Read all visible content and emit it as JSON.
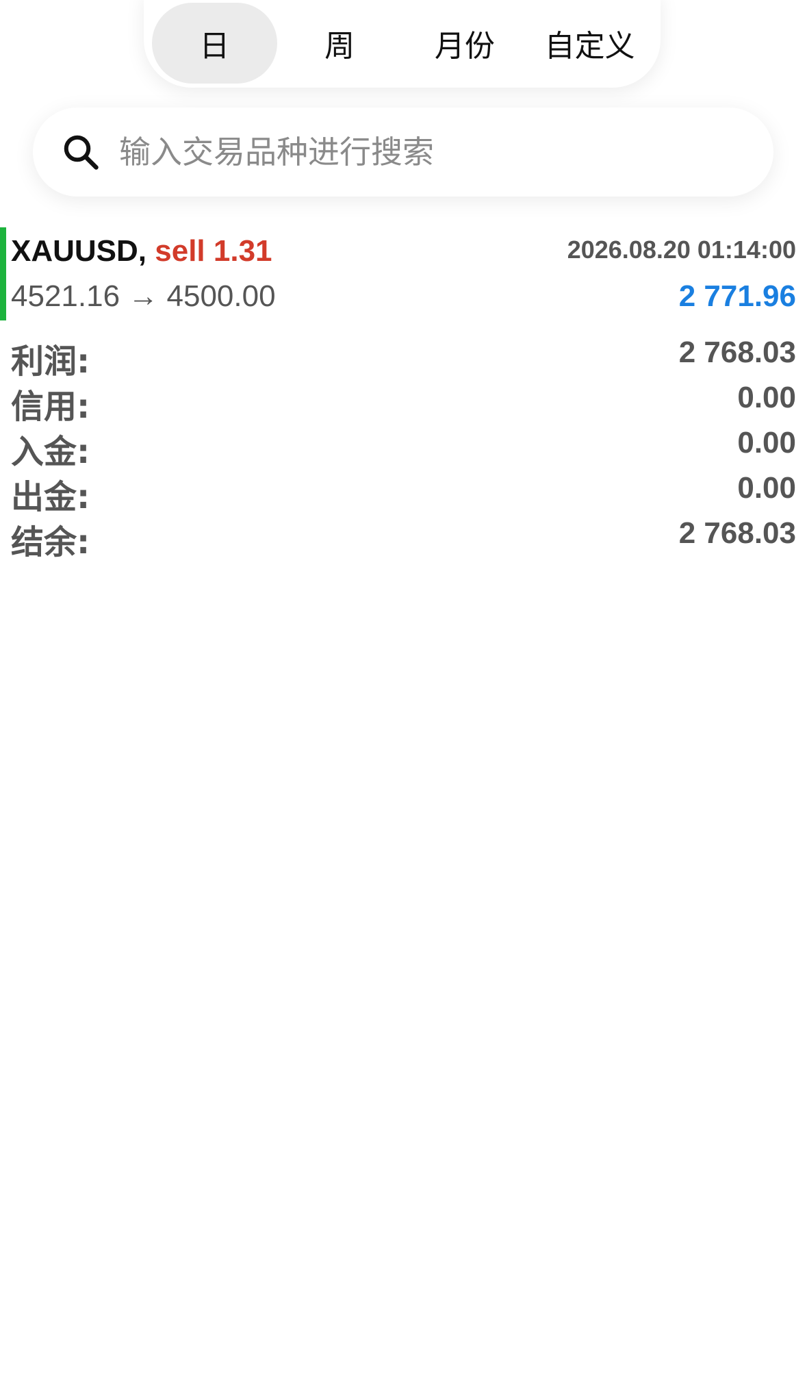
{
  "period_tabs": [
    {
      "label": "日",
      "active": true
    },
    {
      "label": "周",
      "active": false
    },
    {
      "label": "月份",
      "active": false
    },
    {
      "label": "自定义",
      "active": false
    }
  ],
  "search": {
    "placeholder": "输入交易品种进行搜索",
    "icon": "search-icon"
  },
  "trade": {
    "symbol": "XAUUSD,",
    "side": "sell 1.31",
    "time": "2026.08.20 01:14:00",
    "prices": "4521.16 → 4500.00",
    "profit": "2 771.96",
    "colors": {
      "indicator": "#1db33d",
      "side": "#d23b2a",
      "profit": "#1a7fe0"
    }
  },
  "summary": [
    {
      "label": "利润:",
      "value": "2 768.03"
    },
    {
      "label": "信用:",
      "value": "0.00"
    },
    {
      "label": "入金:",
      "value": "0.00"
    },
    {
      "label": "出金:",
      "value": "0.00"
    },
    {
      "label": "结余:",
      "value": "2 768.03"
    }
  ]
}
